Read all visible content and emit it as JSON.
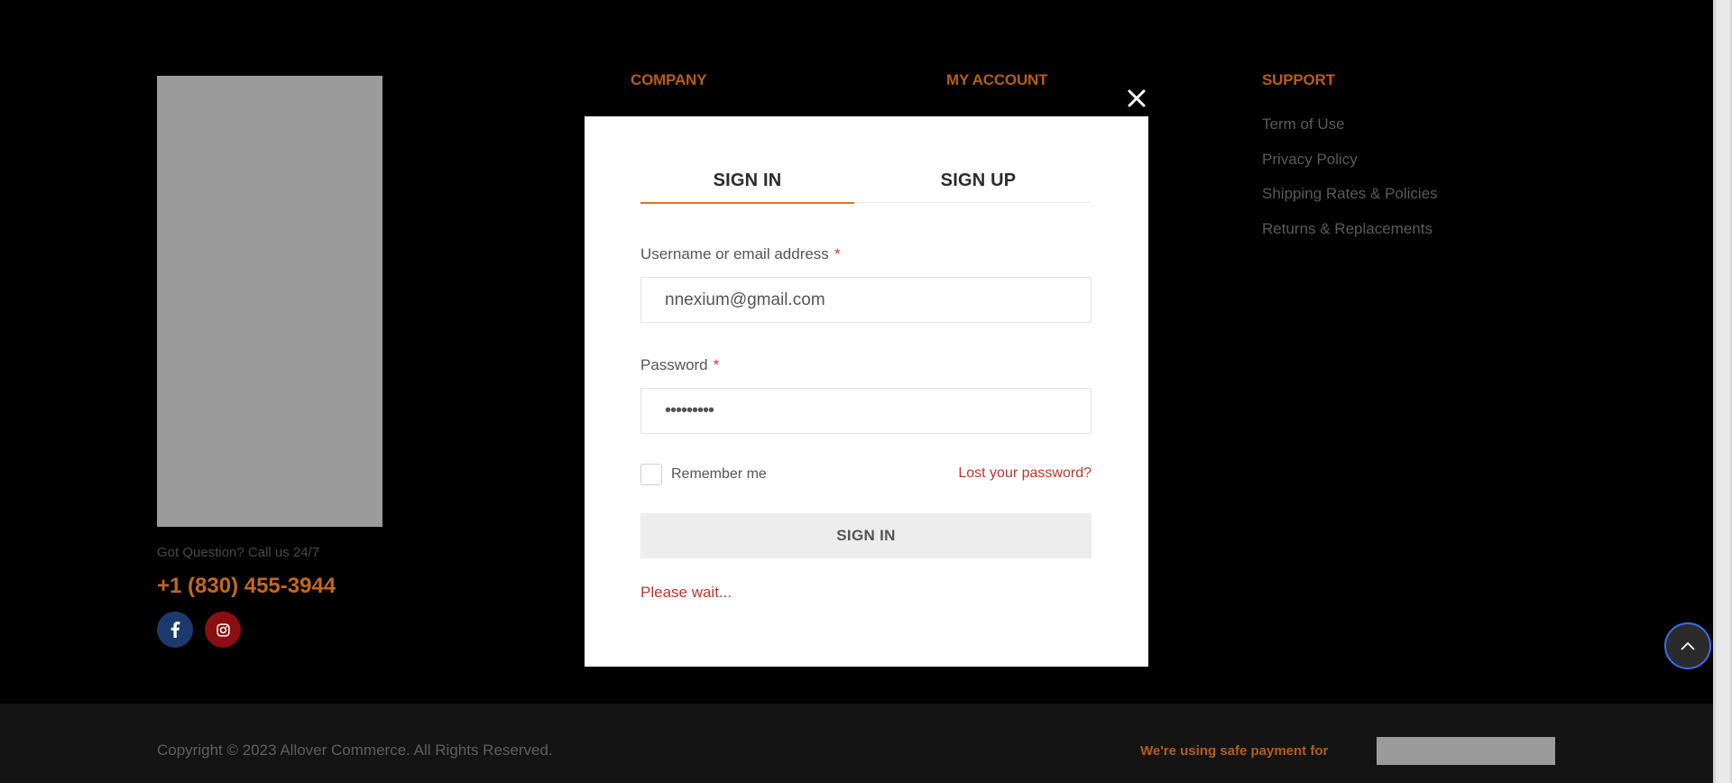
{
  "footer": {
    "got_question": "Got Question? Call us 24/7",
    "phone": "+1 (830) 455-3944",
    "social": [
      "facebook-icon",
      "instagram-icon"
    ],
    "columns": {
      "company": "COMPANY",
      "my_account": "MY ACCOUNT",
      "support": "SUPPORT"
    },
    "support_links": [
      "Term of Use",
      "Privacy Policy",
      "Shipping Rates & Policies",
      "Returns & Replacements"
    ],
    "copyright": "Copyright © 2023 Allover Commerce. All Rights Reserved.",
    "payment_text": "We're using safe payment for"
  },
  "modal": {
    "tabs": {
      "signin": "SIGN IN",
      "signup": "SIGN UP"
    },
    "username_label": "Username or email address",
    "username_value": "nnexium@gmail.com",
    "password_label": "Password",
    "password_value": "•••••••••",
    "required_mark": "*",
    "remember_label": "Remember me",
    "lost_password": "Lost your password?",
    "signin_button": "SIGN IN",
    "status": "Please wait..."
  },
  "colors": {
    "accent": "#d4782c",
    "heading": "#b85c17",
    "error": "#b9372f"
  }
}
